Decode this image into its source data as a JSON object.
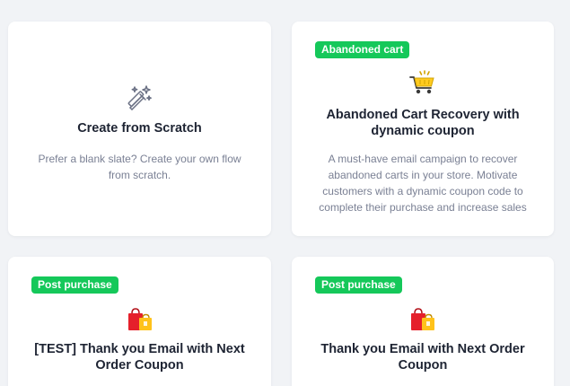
{
  "cards": [
    {
      "badge": "",
      "icon": "magic-wand-icon",
      "title": "Create from Scratch",
      "description": "Prefer a blank slate? Create your own flow from scratch."
    },
    {
      "badge": "Abandoned cart",
      "icon": "shopping-cart-icon",
      "title": "Abandoned Cart Recovery with dynamic coupon",
      "description": "A must-have email campaign to recover abandoned carts in your store. Motivate customers with a dynamic coupon code to complete their purchase and increase sales"
    },
    {
      "badge": "Post purchase",
      "icon": "shopping-bags-icon",
      "title": "[TEST] Thank you Email with Next Order Coupon",
      "description": ""
    },
    {
      "badge": "Post purchase",
      "icon": "shopping-bags-icon",
      "title": "Thank you Email with Next Order Coupon",
      "description": ""
    }
  ],
  "colors": {
    "badge": "#15c85a",
    "title": "#1e2433",
    "description": "#7a8094",
    "background": "#f1f3f6"
  }
}
